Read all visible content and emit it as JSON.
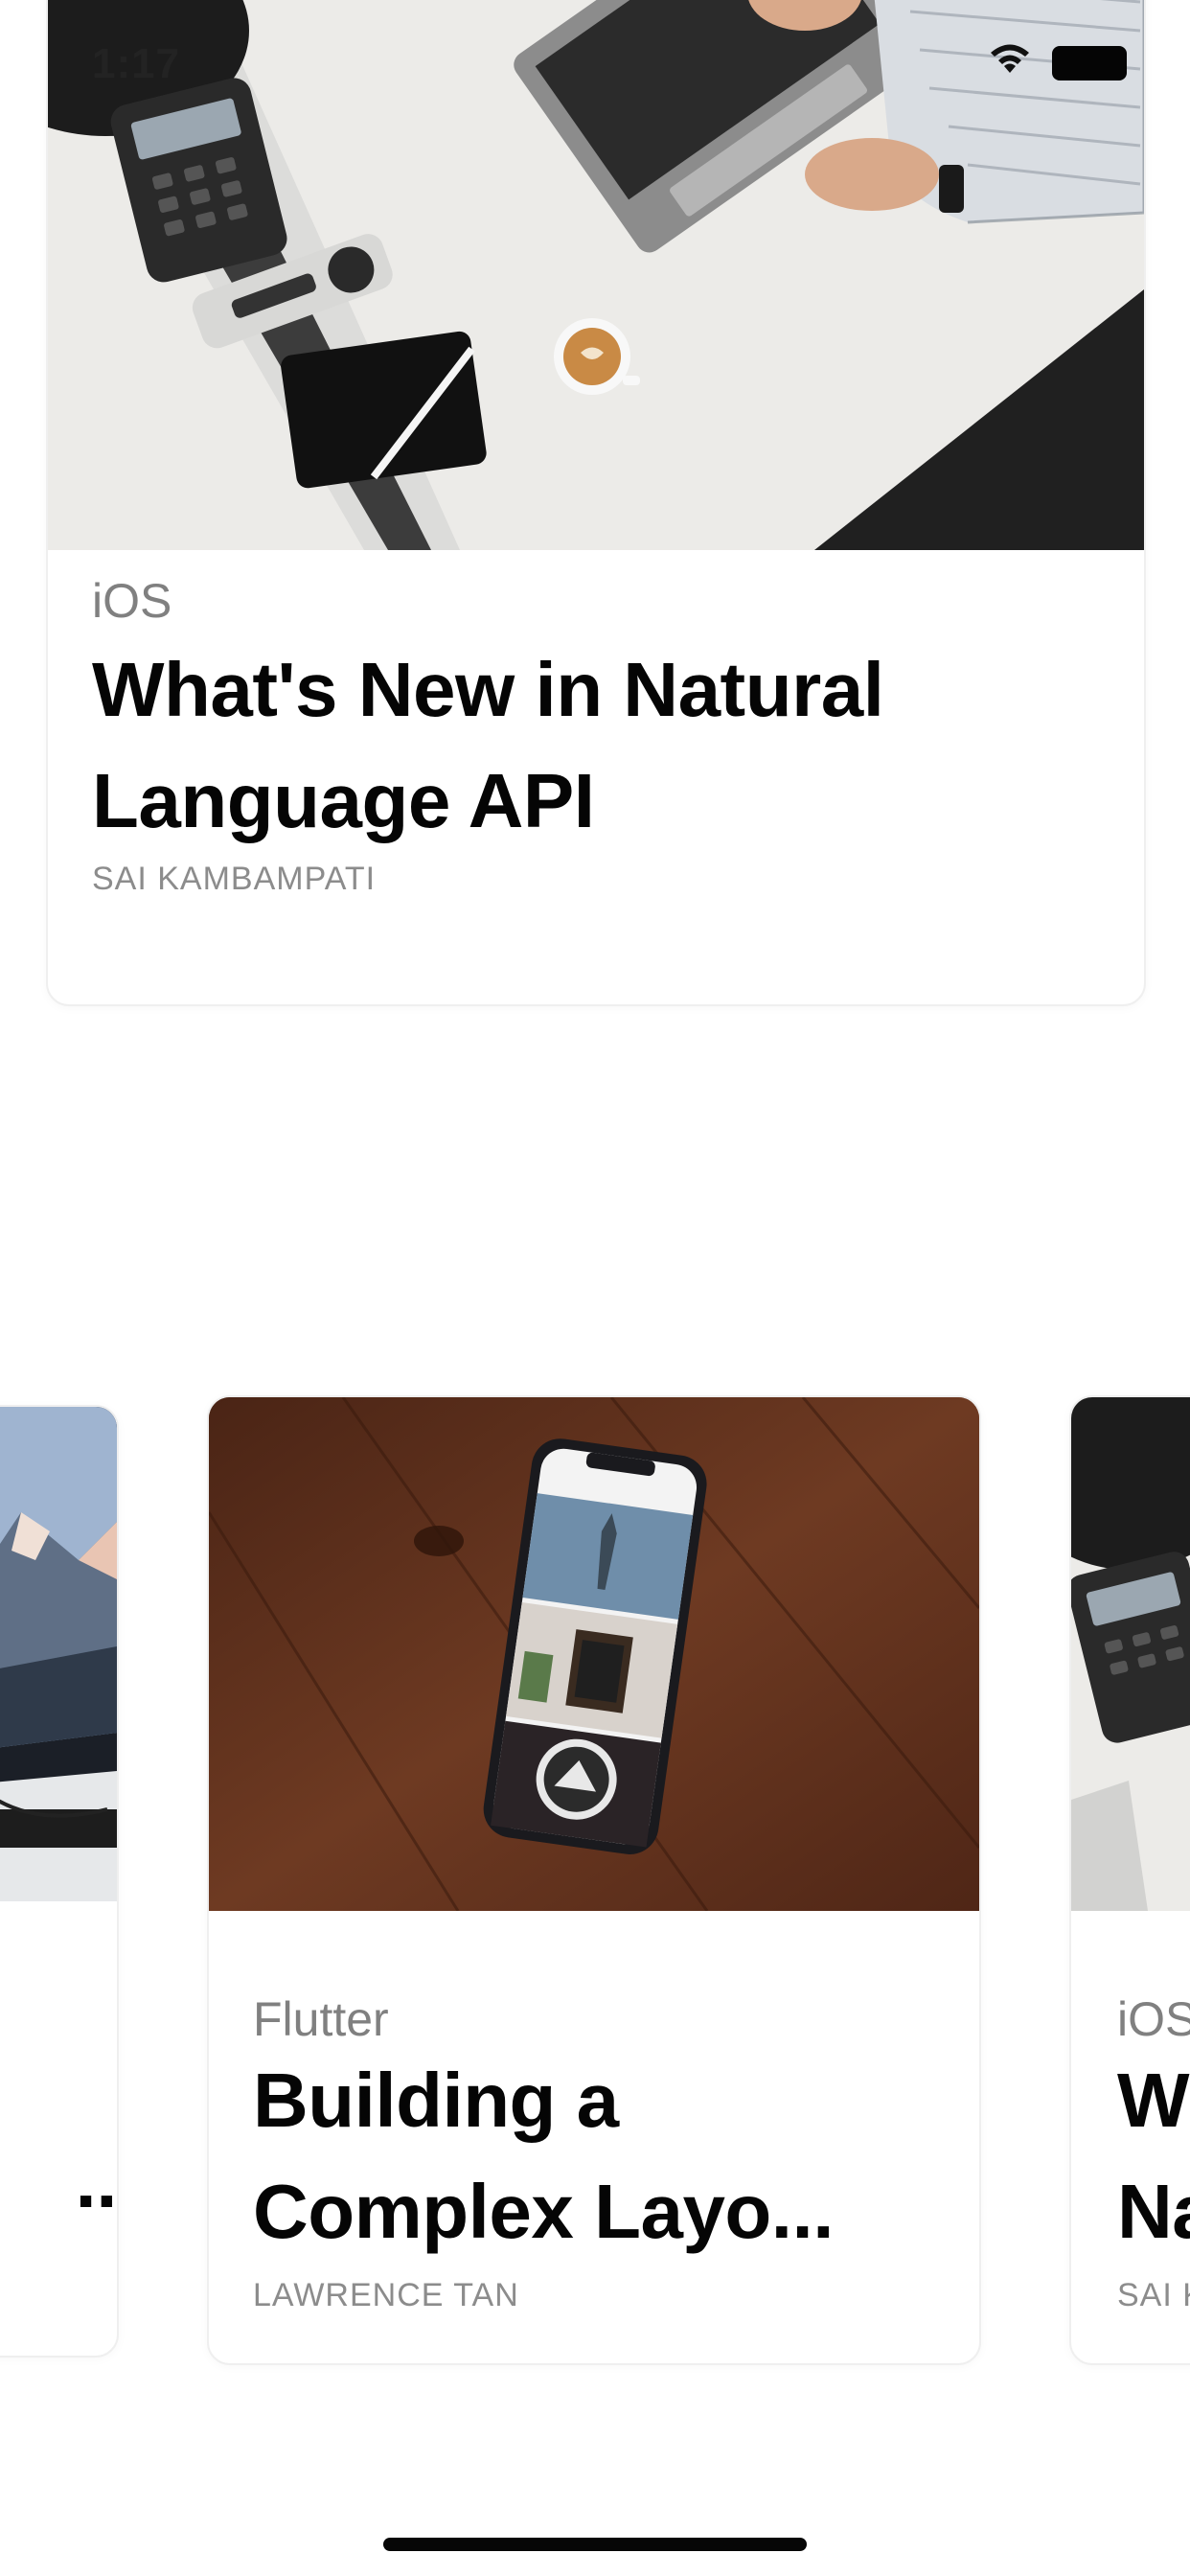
{
  "status_bar": {
    "time": "1:17"
  },
  "hero_card": {
    "category": "iOS",
    "title_line1": "What's New in Natural",
    "title_line2": "Language API",
    "author": "SAI KAMBAMPATI",
    "image_icon": "laptop-desk-photo"
  },
  "carousel": {
    "left_card": {
      "title_fragment": "..",
      "image_icon": "monitor-mountain-photo"
    },
    "center_card": {
      "category": "Flutter",
      "title_line1": "Building a",
      "title_line2": "Complex Layo...",
      "author": "LAWRENCE TAN",
      "image_icon": "phone-on-wood-photo"
    },
    "right_card": {
      "category": "iOS",
      "title_line1": "W",
      "title_line2": "Na",
      "author": "SAI K",
      "image_icon": "laptop-desk-photo"
    }
  },
  "colors": {
    "title": "#050505",
    "category": "#808080",
    "author": "#8c8c8c",
    "card_border": "#efefef"
  }
}
